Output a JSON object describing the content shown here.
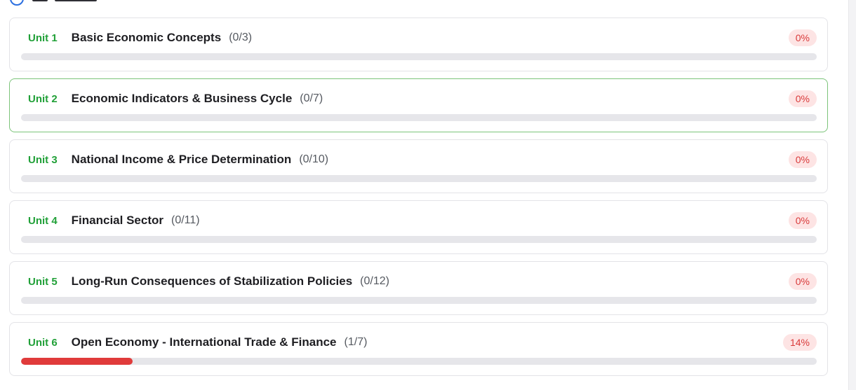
{
  "colors": {
    "unit_label": "#21a038",
    "active_border": "#7cc47a",
    "badge_bg": "#fde4e4",
    "badge_text": "#d93a3a",
    "progress_fill": "#e03b3b",
    "progress_track": "#e6e6ea"
  },
  "units": [
    {
      "label": "Unit 1",
      "title": "Basic Economic Concepts",
      "count": "(0/3)",
      "percent": "0%",
      "progress": 0.0,
      "active": false
    },
    {
      "label": "Unit 2",
      "title": "Economic Indicators & Business Cycle",
      "count": "(0/7)",
      "percent": "0%",
      "progress": 0.0,
      "active": true
    },
    {
      "label": "Unit 3",
      "title": "National Income & Price Determination",
      "count": "(0/10)",
      "percent": "0%",
      "progress": 0.0,
      "active": false
    },
    {
      "label": "Unit 4",
      "title": "Financial Sector",
      "count": "(0/11)",
      "percent": "0%",
      "progress": 0.0,
      "active": false
    },
    {
      "label": "Unit 5",
      "title": "Long-Run Consequences of Stabilization Policies",
      "count": "(0/12)",
      "percent": "0%",
      "progress": 0.0,
      "active": false
    },
    {
      "label": "Unit 6",
      "title": "Open Economy - International Trade & Finance",
      "count": "(1/7)",
      "percent": "14%",
      "progress": 0.14,
      "active": false
    }
  ]
}
